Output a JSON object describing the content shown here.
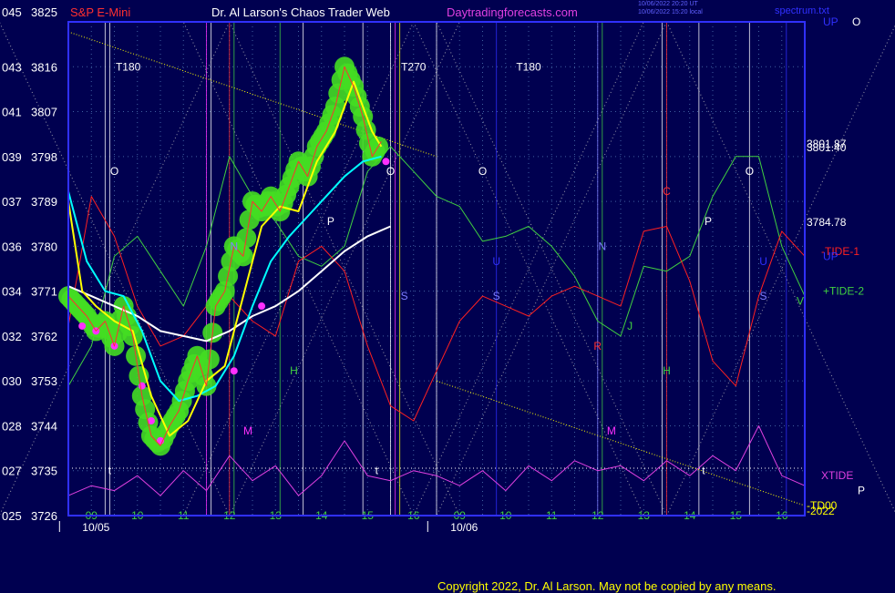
{
  "header": {
    "left_title": "S&P E-Mini",
    "center_title": "Dr. Al Larson's Chaos Trader Web",
    "site": "Daytradingforecasts.com",
    "timestamp_1": "10/06/2022 20:20 UT",
    "timestamp_2": "10/06/2022 15:20 local",
    "right_title": "spectrum.txt"
  },
  "footer": {
    "copyright": "Copyright 2022, Dr. Al Larson. May not be copied by any means."
  },
  "colors": {
    "background": "#000050",
    "frame": "#3030ff",
    "price_bars": "#ff3030",
    "moving_avg_fast": "#ffff00",
    "moving_avg_mid": "#00ffff",
    "moving_avg_slow": "#ffffff",
    "tide_minus": "#ff2020",
    "tide_plus": "#40d040",
    "xtide": "#e040e0",
    "highlight_green": "#44dd22",
    "highlight_magenta": "#ff30ff"
  },
  "chart_data": {
    "type": "line",
    "title": "S&P E-Mini",
    "ylabel_left_codes": [
      "045",
      "043",
      "041",
      "039",
      "037",
      "036",
      "034",
      "032",
      "030",
      "028",
      "027",
      "025"
    ],
    "y_ticks": [
      3825,
      3816,
      3807,
      3798,
      3789,
      3780,
      3771,
      3762,
      3753,
      3744,
      3735,
      3726
    ],
    "ylim": [
      3726,
      3825
    ],
    "x_hours": [
      "09",
      "10",
      "11",
      "12",
      "13",
      "14",
      "15",
      "16",
      "09",
      "10",
      "11",
      "12",
      "13",
      "14",
      "15",
      "16"
    ],
    "x_hour_positions": [
      0.5,
      1.5,
      2.5,
      3.5,
      4.5,
      5.5,
      6.5,
      7.5,
      8.5,
      9.5,
      10.5,
      11.5,
      12.5,
      13.5,
      14.5,
      15.5
    ],
    "xlim": [
      0,
      16
    ],
    "dates": [
      {
        "label": "10/05",
        "x": 0.6
      },
      {
        "label": "10/06",
        "x": 8.6
      }
    ],
    "price_series": {
      "name": "S&P E-Mini",
      "x": [
        0.0,
        0.2,
        0.4,
        0.6,
        0.8,
        1.0,
        1.2,
        1.4,
        1.6,
        1.8,
        2.0,
        2.2,
        2.4,
        2.6,
        2.8,
        3.0,
        3.2,
        3.4,
        3.6,
        3.8,
        4.0,
        4.2,
        4.4,
        4.6,
        4.8,
        5.0,
        5.2,
        5.4,
        5.6,
        5.8,
        6.0,
        6.2,
        6.4,
        6.6,
        6.8,
        7.0,
        7.2,
        7.4
      ],
      "y": [
        3770,
        3768,
        3766,
        3763,
        3765,
        3760,
        3768,
        3762,
        3750,
        3742,
        3740,
        3744,
        3747,
        3753,
        3758,
        3752,
        3768,
        3771,
        3780,
        3778,
        3789,
        3787,
        3790,
        3787,
        3792,
        3797,
        3794,
        3800,
        3803,
        3808,
        3816,
        3812,
        3806,
        3798,
        3801,
        null,
        null,
        null
      ]
    },
    "ma_fast": {
      "x": [
        0.0,
        0.3,
        0.6,
        1.0,
        1.4,
        1.8,
        2.2,
        2.6,
        3.0,
        3.4,
        3.8,
        4.2,
        4.6,
        5.0,
        5.4,
        5.8,
        6.2,
        6.6,
        6.8
      ],
      "y": [
        3789,
        3771,
        3768,
        3765,
        3763,
        3750,
        3742,
        3745,
        3753,
        3756,
        3770,
        3784,
        3788,
        3787,
        3797,
        3803,
        3813,
        3803,
        3800
      ]
    },
    "ma_mid": {
      "x": [
        0.0,
        0.4,
        0.8,
        1.2,
        1.6,
        2.0,
        2.4,
        2.8,
        3.2,
        3.6,
        4.0,
        4.4,
        4.8,
        5.2,
        5.6,
        6.0,
        6.4,
        6.8
      ],
      "y": [
        3791,
        3777,
        3771,
        3770,
        3763,
        3753,
        3749,
        3750,
        3752,
        3758,
        3768,
        3777,
        3782,
        3786,
        3790,
        3794,
        3797,
        3798
      ]
    },
    "ma_slow": {
      "x": [
        0.0,
        0.5,
        1.0,
        1.5,
        2.0,
        2.5,
        3.0,
        3.5,
        4.0,
        4.5,
        5.0,
        5.5,
        6.0,
        6.5,
        7.0
      ],
      "y": [
        3772,
        3770,
        3768,
        3766,
        3763,
        3762,
        3761,
        3763,
        3766,
        3768,
        3771,
        3775,
        3779,
        3782,
        3784
      ]
    },
    "tide_minus": {
      "name": "-TIDE-1",
      "x": [
        0.0,
        0.5,
        1.0,
        1.5,
        2.0,
        2.5,
        3.0,
        3.5,
        4.0,
        4.5,
        5.0,
        5.5,
        6.0,
        6.5,
        7.0,
        7.5,
        8.0,
        8.5,
        9.0,
        9.5,
        10.0,
        10.5,
        11.0,
        11.5,
        12.0,
        12.5,
        13.0,
        13.5,
        14.0,
        14.5,
        15.0,
        15.5,
        16.0
      ],
      "y": [
        3764,
        3790,
        3782,
        3768,
        3760,
        3762,
        3768,
        3770,
        3765,
        3762,
        3777,
        3780,
        3775,
        3760,
        3748,
        3745,
        3755,
        3765,
        3770,
        3768,
        3766,
        3770,
        3772,
        3770,
        3768,
        3783,
        3784,
        3773,
        3757,
        3752,
        3770,
        3783,
        3778
      ]
    },
    "tide_plus": {
      "name": "+TIDE-2",
      "x": [
        0.0,
        0.5,
        1.0,
        1.5,
        2.0,
        2.5,
        3.0,
        3.5,
        4.0,
        4.5,
        5.0,
        5.5,
        6.0,
        6.5,
        7.0,
        7.5,
        8.0,
        8.5,
        9.0,
        9.5,
        10.0,
        10.5,
        11.0,
        11.5,
        12.0,
        12.5,
        13.0,
        13.5,
        14.0,
        14.5,
        15.0,
        15.5,
        16.0
      ],
      "y": [
        3752,
        3760,
        3778,
        3782,
        3775,
        3768,
        3780,
        3798,
        3790,
        3785,
        3778,
        3776,
        3780,
        3795,
        3800,
        3795,
        3790,
        3788,
        3781,
        3782,
        3784,
        3780,
        3774,
        3765,
        3762,
        3776,
        3775,
        3778,
        3790,
        3798,
        3798,
        3780,
        3770
      ]
    },
    "xtide": {
      "name": "XTIDE",
      "x": [
        0.0,
        0.5,
        1.0,
        1.5,
        2.0,
        2.5,
        3.0,
        3.5,
        4.0,
        4.5,
        5.0,
        5.5,
        6.0,
        6.5,
        7.0,
        7.5,
        8.0,
        8.5,
        9.0,
        9.5,
        10.0,
        10.5,
        11.0,
        11.5,
        12.0,
        12.5,
        13.0,
        13.5,
        14.0,
        14.5,
        15.0,
        15.5,
        16.0
      ],
      "y": [
        3730,
        3732,
        3731,
        3734,
        3730,
        3735,
        3731,
        3738,
        3733,
        3736,
        3730,
        3734,
        3741,
        3734,
        3733,
        3735,
        3734,
        3732,
        3735,
        3731,
        3736,
        3733,
        3737,
        3735,
        3736,
        3733,
        3737,
        3734,
        3738,
        3735,
        3744,
        3734,
        3732
      ]
    },
    "price_labels": [
      {
        "text": "3801.87",
        "y": 3800.5
      },
      {
        "text": "3801.40",
        "y": 3799.8
      },
      {
        "text": "3784.78",
        "y": 3784.8
      }
    ],
    "cycle_labels": [
      {
        "text": "T180",
        "x": 1.3,
        "y": 3816
      },
      {
        "text": "T270",
        "x": 7.5,
        "y": 3816
      },
      {
        "text": "T180",
        "x": 10.0,
        "y": 3816
      }
    ],
    "markers": [
      {
        "text": "O",
        "x": 1.0,
        "y": 3795,
        "color": "#ffffff"
      },
      {
        "text": "O",
        "x": 7.0,
        "y": 3795,
        "color": "#ffffff"
      },
      {
        "text": "O",
        "x": 9.0,
        "y": 3795,
        "color": "#ffffff"
      },
      {
        "text": "O",
        "x": 14.8,
        "y": 3795,
        "color": "#ffffff"
      },
      {
        "text": "N",
        "x": 3.6,
        "y": 3780,
        "color": "#8080ff"
      },
      {
        "text": "N",
        "x": 11.6,
        "y": 3780,
        "color": "#8080ff"
      },
      {
        "text": "U",
        "x": 9.3,
        "y": 3777,
        "color": "#3030ff"
      },
      {
        "text": "U",
        "x": 15.1,
        "y": 3777,
        "color": "#3030ff"
      },
      {
        "text": "S",
        "x": 7.3,
        "y": 3770,
        "color": "#8080ff"
      },
      {
        "text": "S",
        "x": 9.3,
        "y": 3770,
        "color": "#8080ff"
      },
      {
        "text": "S",
        "x": 15.1,
        "y": 3770,
        "color": "#8080ff"
      },
      {
        "text": "P",
        "x": 5.7,
        "y": 3785,
        "color": "#ffffff"
      },
      {
        "text": "P",
        "x": 13.9,
        "y": 3785,
        "color": "#ffffff"
      },
      {
        "text": "C",
        "x": 13.0,
        "y": 3791,
        "color": "#ff3030"
      },
      {
        "text": "V",
        "x": 15.9,
        "y": 3769,
        "color": "#40d040"
      },
      {
        "text": "H",
        "x": 4.9,
        "y": 3755,
        "color": "#40d040"
      },
      {
        "text": "H",
        "x": 13.0,
        "y": 3755,
        "color": "#40d040"
      },
      {
        "text": "J",
        "x": 12.2,
        "y": 3764,
        "color": "#40d040"
      },
      {
        "text": "R",
        "x": 11.5,
        "y": 3760,
        "color": "#ff3030"
      },
      {
        "text": "M",
        "x": 3.9,
        "y": 3743,
        "color": "#ff30ff"
      },
      {
        "text": "M",
        "x": 11.8,
        "y": 3743,
        "color": "#ff30ff"
      },
      {
        "text": "t",
        "x": 0.9,
        "y": 3735,
        "color": "#ffffff"
      },
      {
        "text": "t",
        "x": 6.7,
        "y": 3735,
        "color": "#ffffff"
      },
      {
        "text": "t",
        "x": 13.8,
        "y": 3735,
        "color": "#ffffff"
      }
    ],
    "right_labels": [
      {
        "text": "UP",
        "y": 3825,
        "color": "#3030ff"
      },
      {
        "text": "O",
        "y": 3825,
        "color": "#ffffff"
      },
      {
        "text": "-TIDE-1",
        "y": 3779,
        "color": "#ff2020"
      },
      {
        "text": "UP",
        "y": 3778,
        "color": "#3030ff"
      },
      {
        "text": "+TIDE-2",
        "y": 3771,
        "color": "#40d040"
      },
      {
        "text": "XTIDE",
        "y": 3734,
        "color": "#e040e0"
      },
      {
        "text": "P",
        "y": 3731,
        "color": "#ffffff"
      },
      {
        "text": "-TD00",
        "y": 3728,
        "color": "#ffff00"
      },
      {
        "text": "-2022",
        "y": 3726,
        "color": "#ffff00"
      }
    ],
    "grid": true,
    "log_scale": false
  }
}
